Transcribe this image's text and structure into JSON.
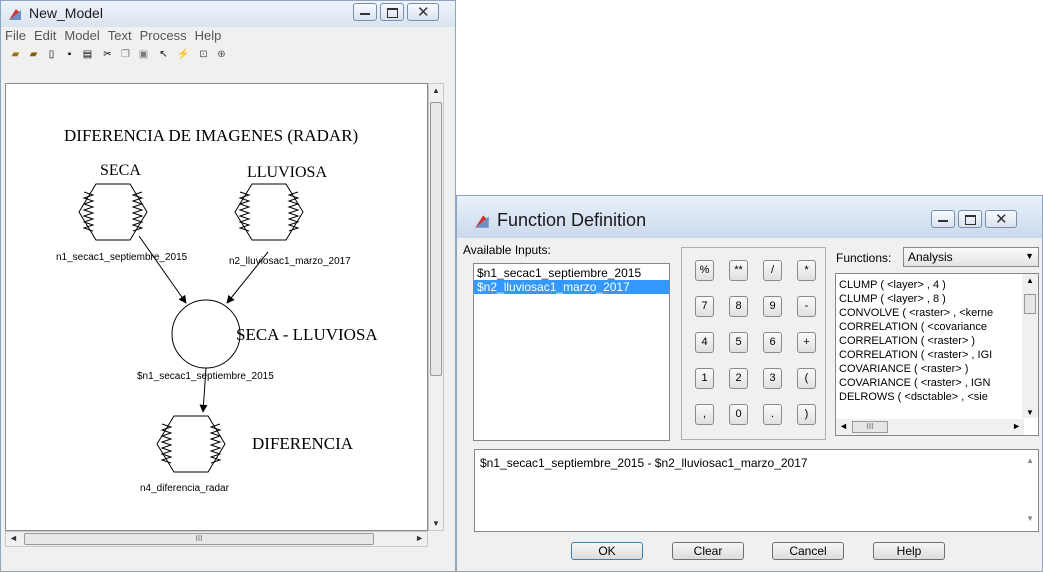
{
  "model_window": {
    "title": "New_Model",
    "menu": [
      "File",
      "Edit",
      "Model",
      "Text",
      "Process",
      "Help"
    ],
    "toolbar_icons": [
      "open-icon",
      "open-folder-icon",
      "new-icon",
      "save-icon",
      "print-icon",
      "cut-icon",
      "copy-icon",
      "paste-icon",
      "select-tool-icon",
      "run-icon",
      "zoom-fit-icon",
      "zoom-icon"
    ],
    "diagram": {
      "title": "DIFERENCIA DE IMAGENES (RADAR)",
      "raster1_title": "SECA",
      "raster1_label": "n1_secac1_septiembre_2015",
      "raster2_title": "LLUVIOSA",
      "raster2_label": "n2_lluviosac1_marzo_2017",
      "function_title": "SECA - LLUVIOSA",
      "function_label": "$n1_secac1_septiembre_2015",
      "output_title": "DIFERENCIA",
      "output_label": "n4_diferencia_radar"
    },
    "hscroll_grip": "III"
  },
  "function_dialog": {
    "title": "Function Definition",
    "available_inputs_label": "Available Inputs:",
    "inputs": [
      "$n1_secac1_septiembre_2015",
      "$n2_lluviosac1_marzo_2017"
    ],
    "selected_input_index": 1,
    "calculator_keys": [
      "%",
      "**",
      "/",
      "*",
      "7",
      "8",
      "9",
      "-",
      "4",
      "5",
      "6",
      "+",
      "1",
      "2",
      "3",
      "(",
      ",",
      "0",
      ".",
      ")"
    ],
    "functions_label": "Functions:",
    "functions_category": "Analysis",
    "functions": [
      "CLUMP ( <layer> , 4 )",
      "CLUMP ( <layer> , 8 )",
      "CONVOLVE ( <raster> , <kerne",
      "CORRELATION ( <covariance",
      "CORRELATION ( <raster> )",
      "CORRELATION ( <raster> , IGI",
      "COVARIANCE ( <raster> )",
      "COVARIANCE ( <raster> , IGN",
      "DELROWS ( <dsctable> , <sie"
    ],
    "functions_hscroll_grip": "III",
    "expression": "$n1_secac1_septiembre_2015 - $n2_lluviosac1_marzo_2017",
    "buttons": {
      "ok": "OK",
      "clear": "Clear",
      "cancel": "Cancel",
      "help": "Help"
    }
  }
}
